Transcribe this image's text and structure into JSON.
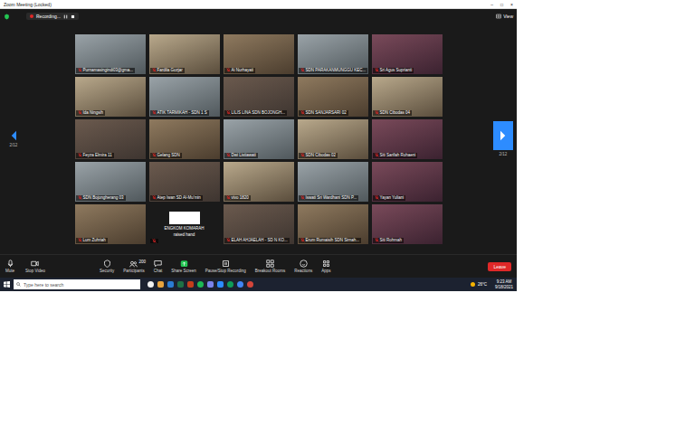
{
  "window": {
    "title": "Zoom Meeting (Locked)",
    "controls": [
      "–",
      "□",
      "×"
    ]
  },
  "topbar": {
    "recording": "Recording...",
    "view": "View"
  },
  "pager": {
    "prev": "2/12",
    "next": "2/12"
  },
  "tiles": [
    {
      "name": "Purnamasingindi03@gma...",
      "kind": "video",
      "muted": true
    },
    {
      "name": "Fardila Gozjar",
      "kind": "video",
      "muted": true
    },
    {
      "name": "Ai Nurhayati",
      "kind": "video",
      "muted": true
    },
    {
      "name": "SDN PARAKANMUNGGU KEC...",
      "kind": "video",
      "muted": true
    },
    {
      "name": "Sri Agus Suprianti",
      "kind": "video",
      "muted": true
    },
    {
      "name": "Ida Ningsih",
      "kind": "video",
      "muted": true
    },
    {
      "name": "ATIK TARMIKAH - SDN 1 S",
      "kind": "video",
      "muted": true
    },
    {
      "name": "LILIS LINA SDN BOJONGH...",
      "kind": "video",
      "muted": true
    },
    {
      "name": "SDN SANJARSARI 02",
      "kind": "video",
      "muted": true
    },
    {
      "name": "SDN Cibodas 04",
      "kind": "video",
      "muted": true
    },
    {
      "name": "Feyza Elmira 11",
      "kind": "video",
      "muted": true
    },
    {
      "name": "Gelang SDN",
      "kind": "video",
      "muted": true
    },
    {
      "name": "Dwi Listiawati",
      "kind": "video",
      "muted": true
    },
    {
      "name": "SDN Cibodas 02",
      "kind": "video",
      "muted": true
    },
    {
      "name": "Siti Sarifah Rohaeni",
      "kind": "video",
      "muted": true
    },
    {
      "name": "SDN Bojongherang 03",
      "kind": "video",
      "muted": true
    },
    {
      "name": "Atep Iwan SD Al-Mu'min",
      "kind": "video",
      "muted": true
    },
    {
      "name": "vivo 1820",
      "kind": "video",
      "muted": true
    },
    {
      "name": "Iswati Sri Wardhani SDN P...",
      "kind": "video",
      "muted": true
    },
    {
      "name": "Yayan Yuliani",
      "kind": "video",
      "muted": true
    },
    {
      "name": "Lum Zuhriah",
      "kind": "video",
      "muted": true
    },
    {
      "name": "ENGKOM KOMARAH",
      "kind": "hand",
      "muted": true,
      "note": "raised hand"
    },
    {
      "name": "ELAH AHJAELAH - SD N KO...",
      "kind": "video",
      "muted": true
    },
    {
      "name": "Erum Rumaisih SDN Sirnah...",
      "kind": "video",
      "muted": true
    },
    {
      "name": "Siti Rohmah",
      "kind": "video",
      "muted": true
    }
  ],
  "toolbar": {
    "left": [
      {
        "label": "Mute",
        "kind": "mic"
      },
      {
        "label": "Stop Video",
        "kind": "video"
      }
    ],
    "center": [
      {
        "label": "Security",
        "kind": "shield"
      },
      {
        "label": "Participants",
        "kind": "people",
        "count": "200"
      },
      {
        "label": "Chat",
        "kind": "chat"
      },
      {
        "label": "Share Screen",
        "kind": "share",
        "color": "#23c552"
      },
      {
        "label": "Pause/Stop Recording",
        "kind": "pause"
      },
      {
        "label": "Breakout Rooms",
        "kind": "breakout"
      },
      {
        "label": "Reactions",
        "kind": "reaction"
      },
      {
        "label": "Apps",
        "kind": "apps"
      }
    ],
    "leave": {
      "label": "Leave",
      "color": "#e02828"
    }
  },
  "taskbar": {
    "search": "Type here to search",
    "weather": "26°C",
    "time": "9:23 AM",
    "date": "9/18/2021"
  }
}
